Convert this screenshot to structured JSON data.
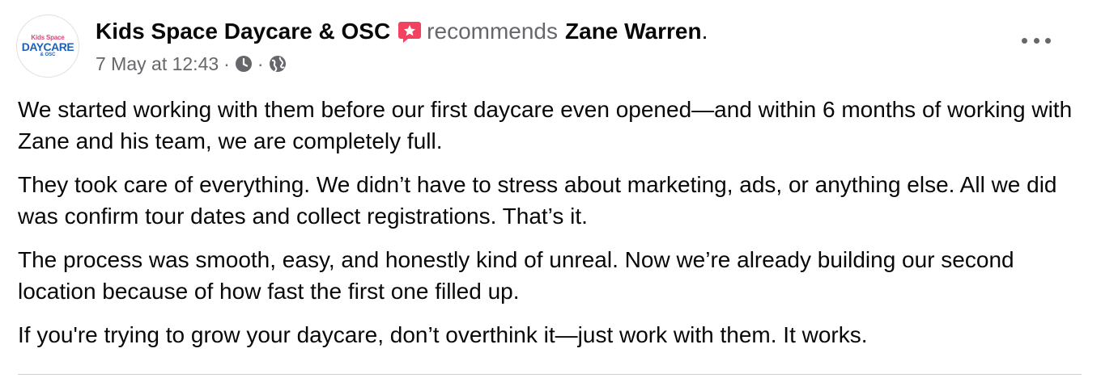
{
  "avatar": {
    "line1": "Kids Space",
    "line2": "DAYCARE",
    "line3": "& OSC"
  },
  "header": {
    "page_name": "Kids Space Daycare & OSC",
    "verb": "recommends",
    "target": "Zane Warren",
    "period": ".",
    "badge_icon": "recommendation-star-icon",
    "badge_color": "#f3425f"
  },
  "meta": {
    "timestamp": "7 May at 12:43",
    "separator": "·",
    "icons": [
      "clock-icon",
      "globe-icon"
    ]
  },
  "more_icon": "more-options-icon",
  "body": {
    "paragraphs": [
      "We started working with them before our first daycare even opened—and within 6 months of working with Zane and his team, we are completely full.",
      "They took care of everything. We didn’t have to stress about marketing, ads, or anything else. All we did was confirm tour dates and collect registrations. That’s it.",
      "The process was smooth, easy, and honestly kind of unreal. Now we’re already building our second location because of how fast the first one filled up.",
      "If you're trying to grow your daycare, don’t overthink it—just work with them. It works."
    ]
  }
}
